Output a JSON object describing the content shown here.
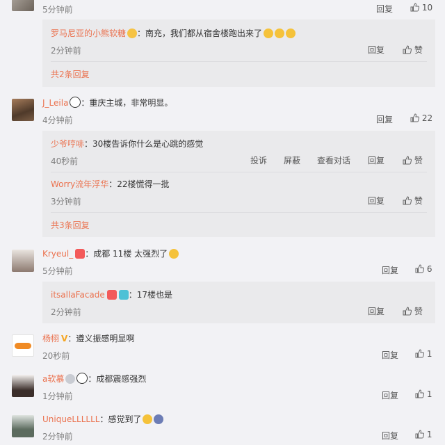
{
  "comments": [
    {
      "id": "c0",
      "name": "",
      "text": "",
      "time": "5分钟前",
      "reply": "回复",
      "likes": "10"
    },
    {
      "id": "c1",
      "name": "J_Leila",
      "text": "：重庆主城，非常明显。",
      "time": "4分钟前",
      "reply": "回复",
      "likes": "22"
    },
    {
      "id": "c2",
      "name": "Kryeul_",
      "text": "：成都 11楼 太强烈了",
      "time": "5分钟前",
      "reply": "回复",
      "likes": "6"
    },
    {
      "id": "c3",
      "name": "杨栩",
      "text": "：遵义振感明显啊",
      "time": "20秒前",
      "reply": "回复",
      "likes": "1"
    },
    {
      "id": "c4",
      "name": "a软慕",
      "text": "：成都震感强烈",
      "time": "1分钟前",
      "reply": "回复",
      "likes": "1"
    },
    {
      "id": "c5",
      "name": "UniqueLLLLLL",
      "text": "：感觉到了",
      "time": "2分钟前",
      "reply": "回复",
      "likes": "1"
    }
  ],
  "replies": [
    {
      "name": "罗马尼亚的小熊软糖",
      "text": "：南充，我们都从宿舍楼跑出来了",
      "time": "2分钟前",
      "reply": "回复",
      "like": "赞"
    },
    {
      "name": "少爷哼哧",
      "text": "：30楼告诉你什么是心跳的感觉",
      "time": "40秒前",
      "report": "投诉",
      "block": "屏蔽",
      "view": "查看对话",
      "reply": "回复",
      "like": "赞"
    },
    {
      "name": "Worry流年浮华",
      "text": "：22楼慌得一批",
      "time": "3分钟前",
      "reply": "回复",
      "like": "赞"
    },
    {
      "name": "itsallaFacade",
      "text": "：17楼也是",
      "time": "2分钟前",
      "reply": "回复",
      "like": "赞"
    }
  ],
  "more": [
    "共2条回复",
    "共3条回复"
  ],
  "colors": {
    "name": "#eb7350",
    "background": "#f2f2f5",
    "reply_box": "#eaeaec"
  }
}
